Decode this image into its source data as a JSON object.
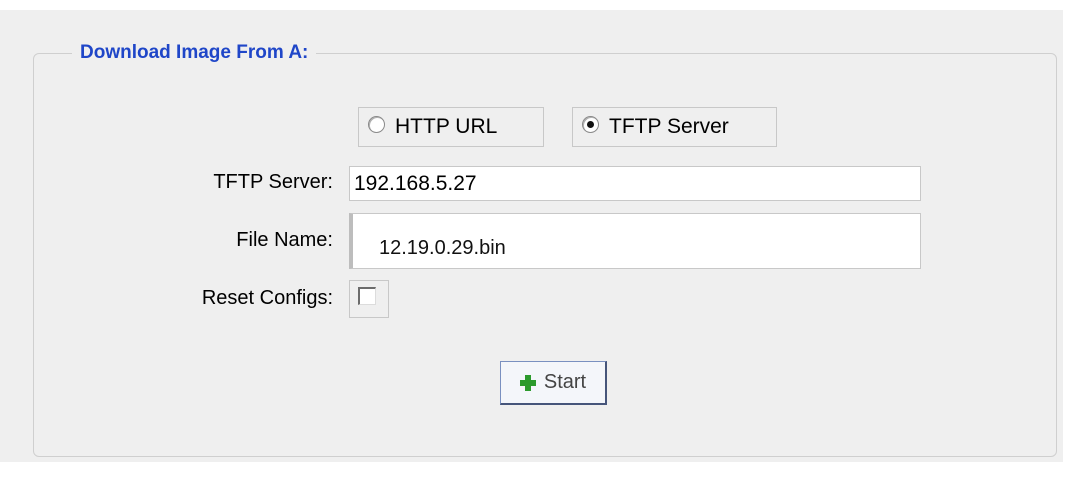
{
  "section": {
    "legend": "Download Image From A:"
  },
  "source": {
    "options": [
      {
        "label": "HTTP URL",
        "checked": false
      },
      {
        "label": "TFTP Server",
        "checked": true
      }
    ]
  },
  "form": {
    "tftp_server_label": "TFTP Server:",
    "tftp_server_value": "192.168.5.27",
    "file_name_label": "File Name:",
    "file_name_value": "12.19.0.29.bin",
    "reset_configs_label": "Reset Configs:",
    "reset_configs_checked": false
  },
  "actions": {
    "start_label": "Start",
    "start_icon": "plus-icon"
  },
  "colors": {
    "legend_text": "#1f46c8",
    "panel_background": "#efefef",
    "plus_icon": "#2c9a2c"
  }
}
